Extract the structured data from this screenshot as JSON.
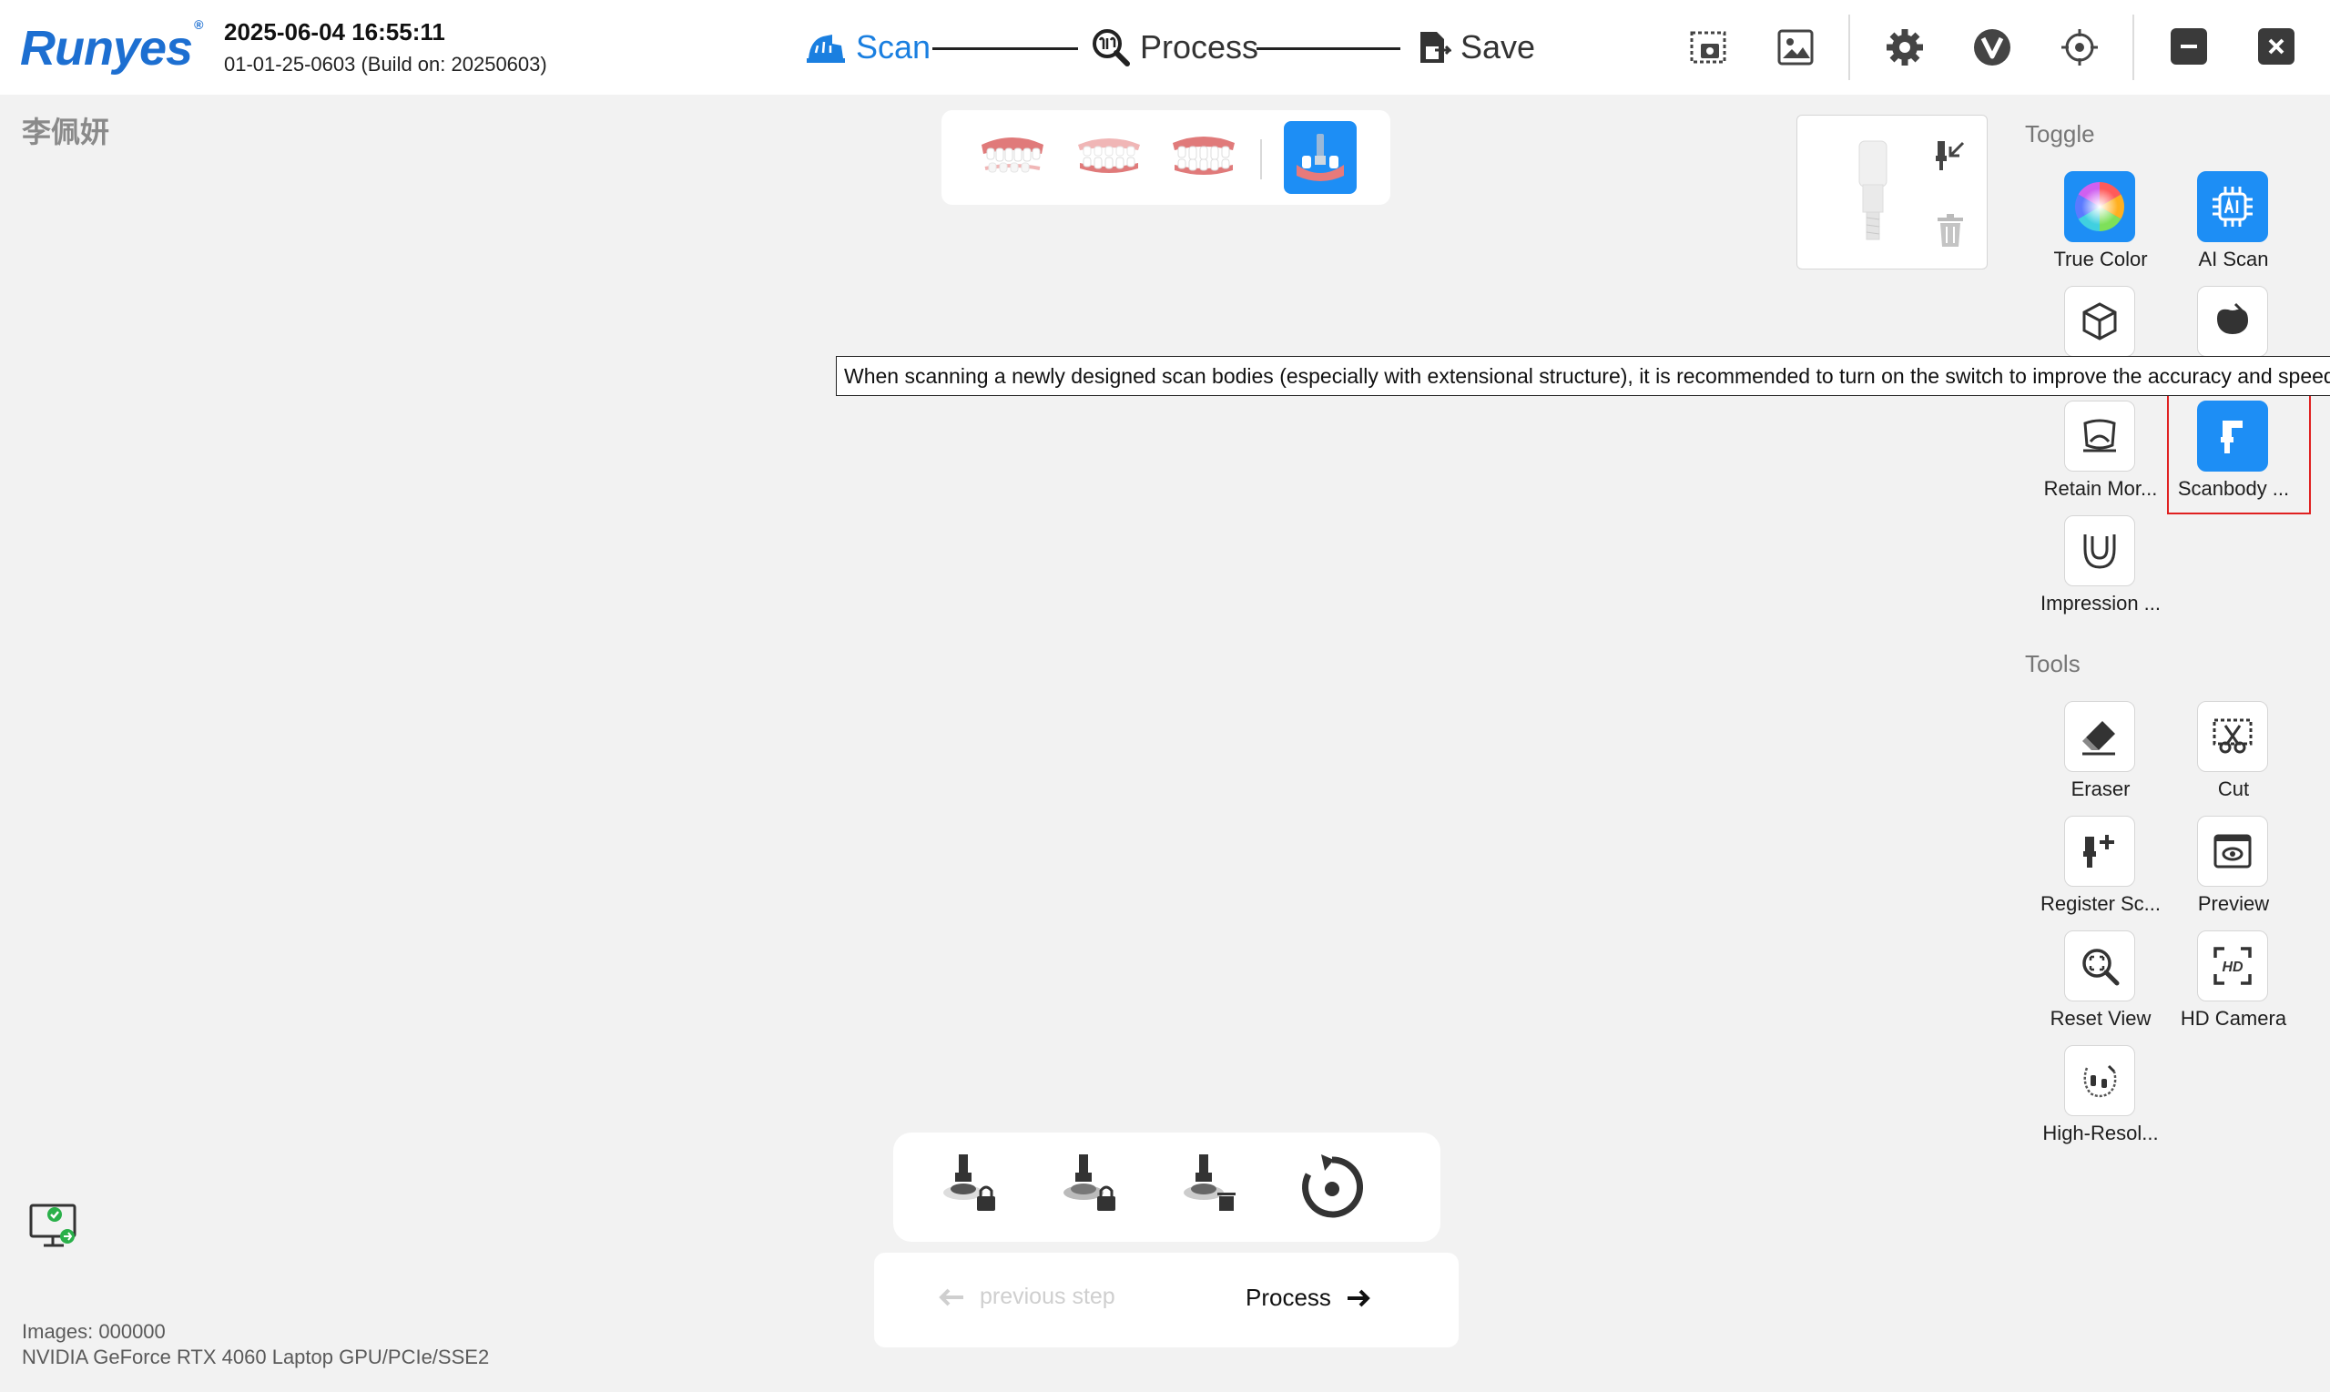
{
  "app": {
    "logo": "Runyes",
    "logo_mark": "®",
    "datetime": "2025-06-04 16:55:11",
    "build": "01-01-25-0603 (Build on: 20250603)"
  },
  "workflow": {
    "steps": [
      {
        "label": "Scan",
        "active": true,
        "icon": "scan-icon"
      },
      {
        "label": "Process",
        "active": false,
        "icon": "process-icon"
      },
      {
        "label": "Save",
        "active": false,
        "icon": "save-icon"
      }
    ]
  },
  "toolbar_icons": [
    "screenshot-icon",
    "gallery-icon",
    "settings-icon",
    "v-logo-icon",
    "target-icon",
    "minimize-icon",
    "close-icon"
  ],
  "patient": {
    "name": "李佩妍"
  },
  "jaw_selector": {
    "items": [
      "upper-jaw",
      "both-jaws",
      "lower-jaw",
      "implant-scanbody"
    ],
    "active": "implant-scanbody"
  },
  "right_panel": {
    "toggle_title": "Toggle",
    "toggles": [
      {
        "label": "True Color",
        "icon": "color-wheel-icon",
        "on": true
      },
      {
        "label": "AI Scan",
        "icon": "ai-chip-icon",
        "on": true
      },
      {
        "label": "",
        "icon": "cube-icon",
        "on": false
      },
      {
        "label": "",
        "icon": "tooth-icon",
        "on": false
      },
      {
        "label": "Retain Mor...",
        "icon": "retain-icon",
        "on": false
      },
      {
        "label": "Scanbody ...",
        "icon": "scanbody-icon",
        "on": true
      },
      {
        "label": "Impression ...",
        "icon": "impression-icon",
        "on": false
      }
    ],
    "tools_title": "Tools",
    "tools": [
      {
        "label": "Eraser",
        "icon": "eraser-icon"
      },
      {
        "label": "Cut",
        "icon": "cut-icon"
      },
      {
        "label": "Register Sc...",
        "icon": "register-scanbody-icon"
      },
      {
        "label": "Preview",
        "icon": "preview-icon"
      },
      {
        "label": "Reset View",
        "icon": "reset-view-icon"
      },
      {
        "label": "HD Camera",
        "icon": "hd-camera-icon"
      },
      {
        "label": "High-Resol...",
        "icon": "high-resolution-icon"
      }
    ]
  },
  "tooltip": "When scanning a newly designed scan bodies (especially with extensional structure), it is recommended to turn on the switch to improve the accuracy and speed",
  "bottom": {
    "lock_buttons": [
      "lock-scan-1",
      "lock-scan-2",
      "delete-locked",
      "reset-rotation"
    ],
    "prev_label": "previous step",
    "next_label": "Process"
  },
  "status": {
    "images": "Images: 000000",
    "gpu": "NVIDIA GeForce RTX 4060 Laptop GPU/PCIe/SSE2"
  },
  "colors": {
    "accent": "#1d8ef5",
    "highlight": "#e02020"
  }
}
